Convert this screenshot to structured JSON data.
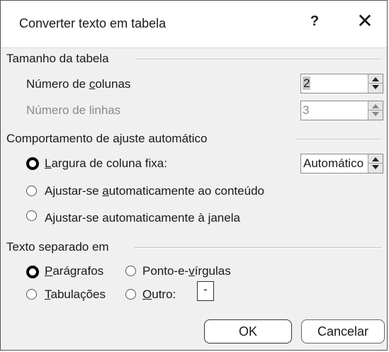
{
  "dialog": {
    "title": "Converter texto em tabela",
    "help_label": "?",
    "close_label": "✕"
  },
  "table_size": {
    "heading": "Tamanho da tabela",
    "columns_label_pre": "Número de ",
    "columns_label_u": "c",
    "columns_label_post": "olunas",
    "columns_value": "2",
    "rows_label": "Número de linhas",
    "rows_value": "3"
  },
  "autofit": {
    "heading": "Comportamento de ajuste automático",
    "fixed_u": "L",
    "fixed_post": "argura de coluna fixa:",
    "fixed_value": "Automático",
    "contents_pre": "Ajustar-se ",
    "contents_u": "a",
    "contents_post": "utomaticamente ao conteúdo",
    "window_pre": "Ajustar-se automaticamente à ",
    "window_u": "j",
    "window_post": "anela",
    "selected": "fixed"
  },
  "separator": {
    "heading": "Texto separado em",
    "paragraphs_u": "P",
    "paragraphs_post": "arágrafos",
    "semicolons_pre": "Ponto-e-",
    "semicolons_u": "v",
    "semicolons_post": "írgulas",
    "tabs_u": "T",
    "tabs_post": "abulações",
    "other_u": "O",
    "other_post": "utro:",
    "other_value": "-",
    "selected": "paragraphs"
  },
  "buttons": {
    "ok": "OK",
    "cancel": "Cancelar"
  }
}
